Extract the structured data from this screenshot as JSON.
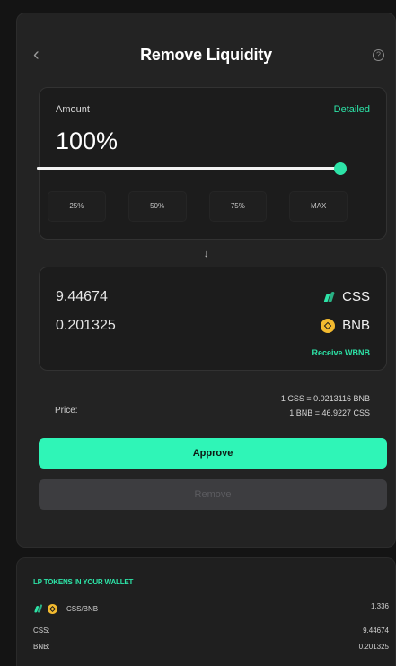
{
  "header": {
    "title": "Remove Liquidity"
  },
  "amount": {
    "label": "Amount",
    "detailed_link": "Detailed",
    "value_text": "100%",
    "slider_percent": 100,
    "presets": [
      "25%",
      "50%",
      "75%",
      "MAX"
    ]
  },
  "arrow": "↓",
  "receive": {
    "items": [
      {
        "amount": "9.44674",
        "token": "CSS",
        "icon": "css-token-icon"
      },
      {
        "amount": "0.201325",
        "token": "BNB",
        "icon": "bnb-token-icon"
      }
    ],
    "receive_wbnb": "Receive WBNB"
  },
  "price": {
    "label": "Price:",
    "line1": "1 CSS = 0.0213116 BNB",
    "line2": "1 BNB = 46.9227 CSS"
  },
  "actions": {
    "approve": "Approve",
    "remove": "Remove"
  },
  "wallet": {
    "title": "LP TOKENS IN YOUR WALLET",
    "pair": "CSS/BNB",
    "pair_amount": "1.336",
    "rows": [
      {
        "label": "CSS:",
        "value": "9.44674"
      },
      {
        "label": "BNB:",
        "value": "0.201325"
      }
    ]
  },
  "colors": {
    "accent": "#2de3a7",
    "approve_bg": "#2ff5b7",
    "bnb": "#f3ba2f",
    "card": "#232323"
  }
}
